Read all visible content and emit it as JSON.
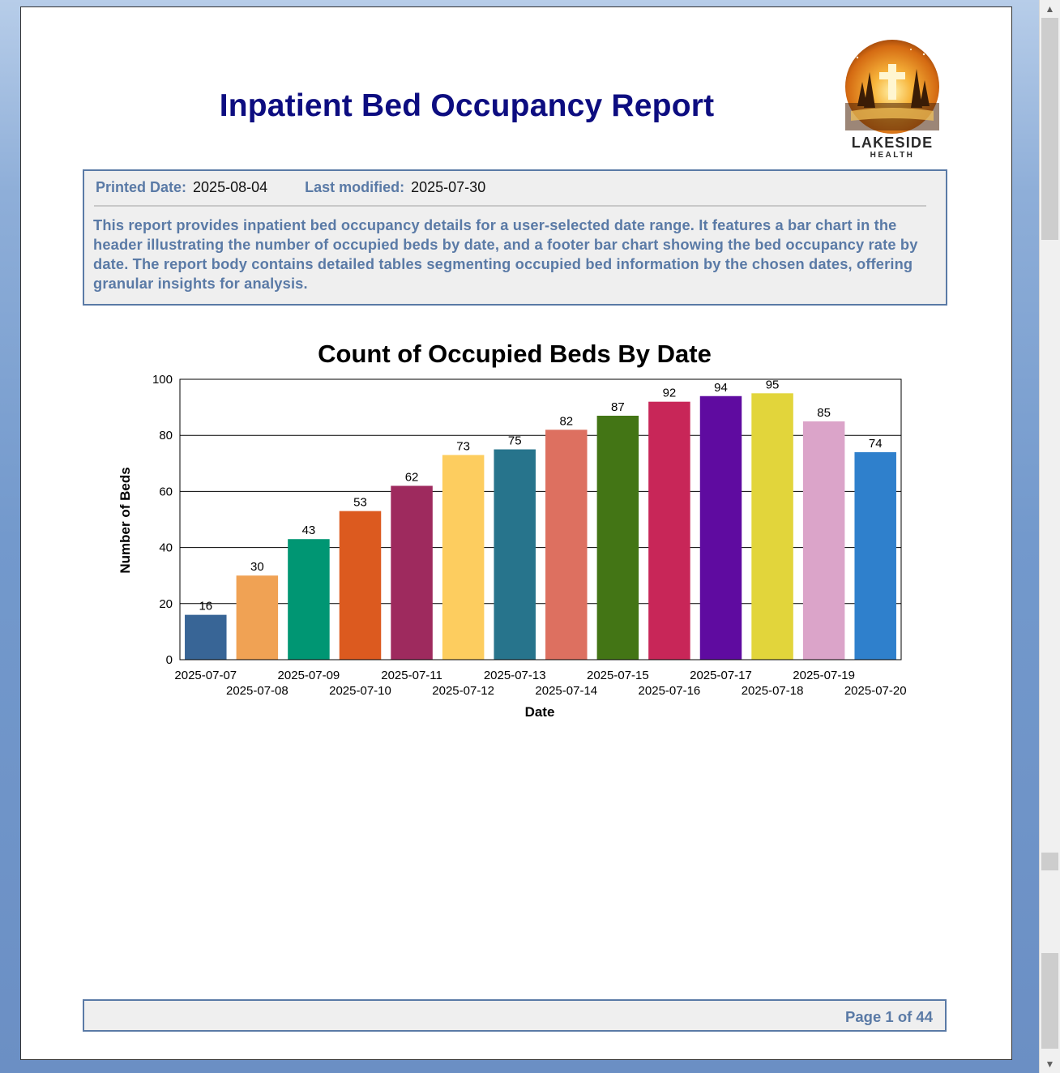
{
  "report": {
    "title": "Inpatient Bed Occupancy Report",
    "logo": {
      "name": "LAKESIDE",
      "tagline": "HEALTH"
    },
    "printed_date_label": "Printed Date:",
    "printed_date": "2025-08-04",
    "last_modified_label": "Last modified:",
    "last_modified": "2025-07-30",
    "description": "This report provides inpatient bed occupancy details for a user-selected date range. It features a bar chart in the header illustrating the number of occupied beds by date, and a footer bar chart showing the bed occupancy rate by date. The report body contains detailed tables segmenting occupied bed information by the chosen dates, offering granular insights for analysis.",
    "page_indicator": "Page 1 of 44"
  },
  "chart_data": {
    "type": "bar",
    "title": "Count of Occupied Beds By Date",
    "xlabel": "Date",
    "ylabel": "Number of Beds",
    "ylim": [
      0,
      100
    ],
    "yticks": [
      0,
      20,
      40,
      60,
      80,
      100
    ],
    "grid": true,
    "categories": [
      "2025-07-07",
      "2025-07-08",
      "2025-07-09",
      "2025-07-10",
      "2025-07-11",
      "2025-07-12",
      "2025-07-13",
      "2025-07-14",
      "2025-07-15",
      "2025-07-16",
      "2025-07-17",
      "2025-07-18",
      "2025-07-19",
      "2025-07-20"
    ],
    "values": [
      16,
      30,
      43,
      53,
      62,
      73,
      75,
      82,
      87,
      92,
      94,
      95,
      85,
      74
    ],
    "colors": [
      "#386596",
      "#f0a254",
      "#009673",
      "#dc5a1f",
      "#9e2a5e",
      "#fdcd5f",
      "#27748c",
      "#dd7060",
      "#437515",
      "#c82658",
      "#5f0ba0",
      "#e2d53b",
      "#dba4c9",
      "#2f80cc"
    ]
  },
  "theme": {
    "title_color": "#0d0d80",
    "accent_color": "#5a7aa6",
    "panel_background": "#efefef"
  },
  "viewer": {
    "scroll_up_icon": "triangle-up-icon",
    "scroll_down_icon": "triangle-down-icon"
  }
}
